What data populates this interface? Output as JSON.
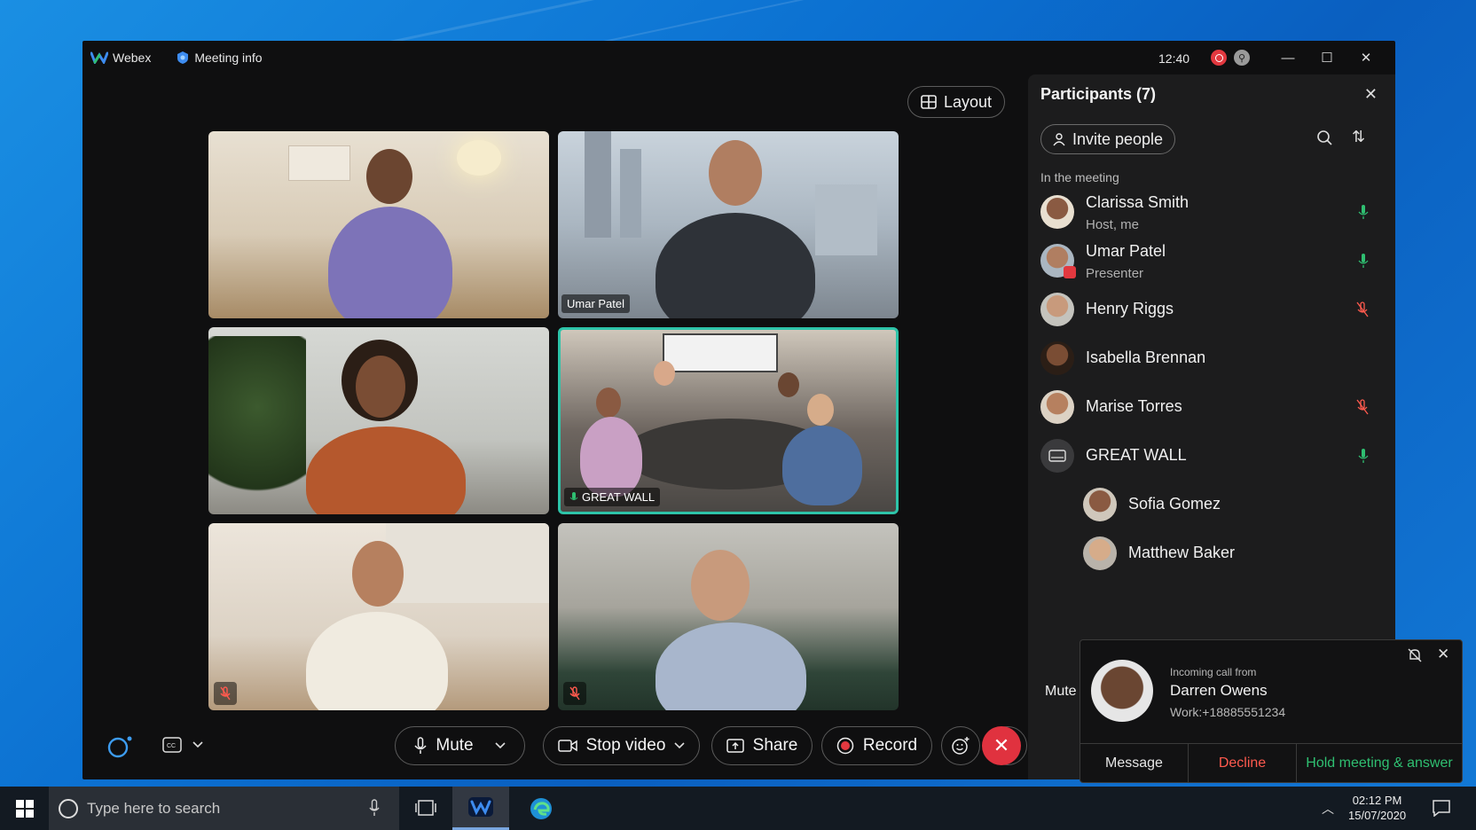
{
  "titlebar": {
    "app_name": "Webex",
    "meeting_info": "Meeting info",
    "time": "12:40"
  },
  "layout_button": "Layout",
  "tiles": [
    {
      "name": ""
    },
    {
      "name": "Umar Patel"
    },
    {
      "name": ""
    },
    {
      "name": "GREAT WALL"
    },
    {
      "name": ""
    },
    {
      "name": ""
    }
  ],
  "participants_panel": {
    "title": "Participants (7)",
    "invite": "Invite people",
    "section": "In the meeting",
    "people": [
      {
        "name": "Clarissa Smith",
        "role": "Host, me",
        "mic": "on"
      },
      {
        "name": "Umar Patel",
        "role": "Presenter",
        "mic": "on"
      },
      {
        "name": "Henry Riggs",
        "role": "",
        "mic": "muted"
      },
      {
        "name": "Isabella Brennan",
        "role": "",
        "mic": "none"
      },
      {
        "name": "Marise Torres",
        "role": "",
        "mic": "muted"
      },
      {
        "name": "GREAT WALL",
        "role": "",
        "mic": "on"
      },
      {
        "name": "Sofia Gomez",
        "role": "",
        "mic": "none"
      },
      {
        "name": "Matthew Baker",
        "role": "",
        "mic": "none"
      }
    ]
  },
  "toolbar": {
    "mute": "Mute",
    "stop_video": "Stop video",
    "share": "Share",
    "record": "Record",
    "more": "···"
  },
  "incoming_call": {
    "subtitle": "Incoming call from",
    "caller": "Darren Owens",
    "number": "Work:+18885551234",
    "message": "Message",
    "decline": "Decline",
    "hold_answer": "Hold meeting & answer",
    "mute_edge": "Mute"
  },
  "taskbar": {
    "search_placeholder": "Type here to search",
    "time": "02:12 PM",
    "date": "15/07/2020"
  },
  "colors": {
    "accent_green": "#2fbf71",
    "decline_red": "#ff5a4e",
    "end_call_red": "#e0323f",
    "active_tile_border": "#2ec4a9"
  }
}
